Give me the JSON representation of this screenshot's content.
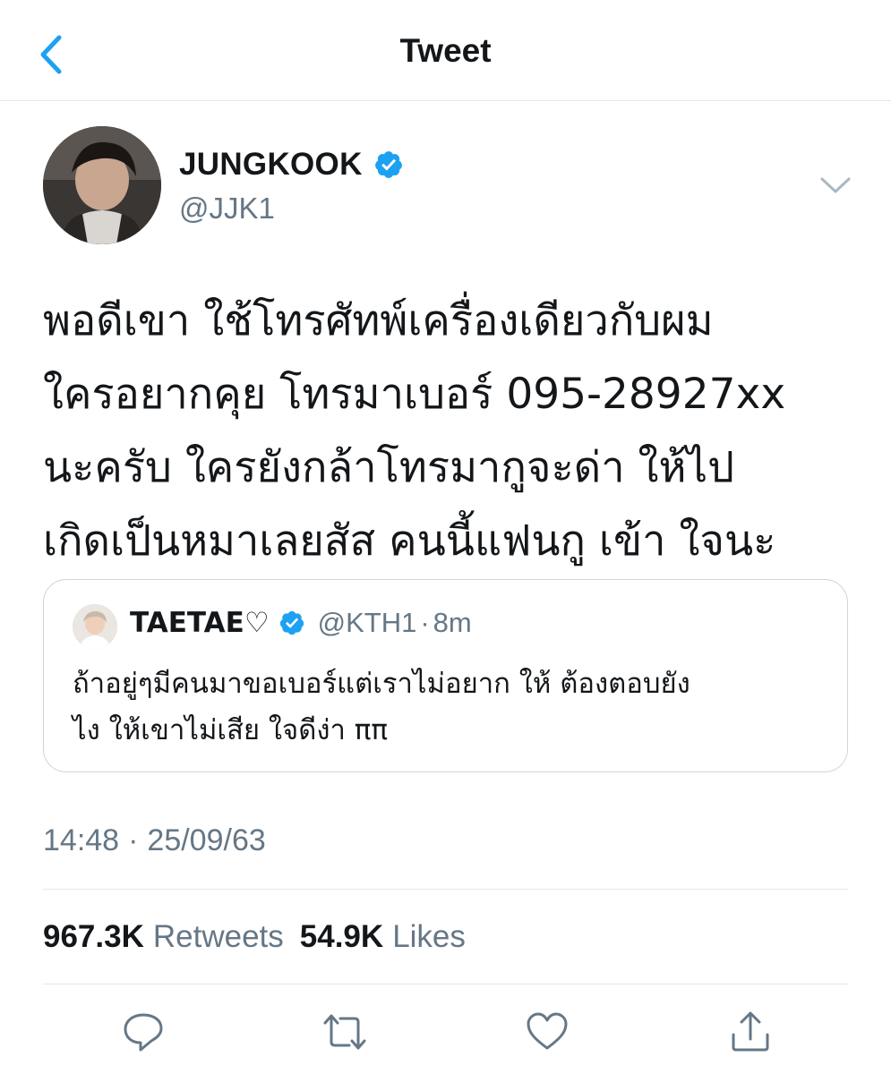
{
  "header": {
    "title": "Tweet",
    "back_icon": "chevron-left-icon"
  },
  "author": {
    "name": "JUNGKOOK",
    "handle": "@JJK1",
    "verified": true
  },
  "tweet": {
    "lines": [
      "พอดีเขา ใช้โทรศัทพ์เครื่องเดียวกับผม",
      " ใครอยากคุย โทรมาเบอร์ 095-28927xx",
      "นะครับ  ใครยังกล้าโทรมากูจะด่า ให้ไป",
      "เกิดเป็นหมาเลยสัส คนนี้แฟนกู เข้า ใจนะ"
    ]
  },
  "quoted_tweet": {
    "name": "TAETAE♡",
    "handle": "@KTH1",
    "separator": "·",
    "time": "8m",
    "verified": true,
    "lines": [
      "ถ้าอยู่ๆมีคนมาขอเบอร์แต่เราไม่อยาก ให้ ต้องตอบยัง",
      "ไง ให้เขาไม่เสีย ใจดีง่า ππ"
    ]
  },
  "timestamp": {
    "time": "14:48",
    "separator": "·",
    "date": "25/09/63"
  },
  "stats": {
    "retweets_value": "967.3K",
    "retweets_label": "Retweets",
    "likes_value": "54.9K",
    "likes_label": "Likes"
  },
  "actions": [
    "reply-icon",
    "retweet-icon",
    "like-icon",
    "share-icon"
  ],
  "colors": {
    "accent": "#1da1f2",
    "text": "#14171a",
    "muted": "#657786",
    "border": "#e1e8ed"
  }
}
